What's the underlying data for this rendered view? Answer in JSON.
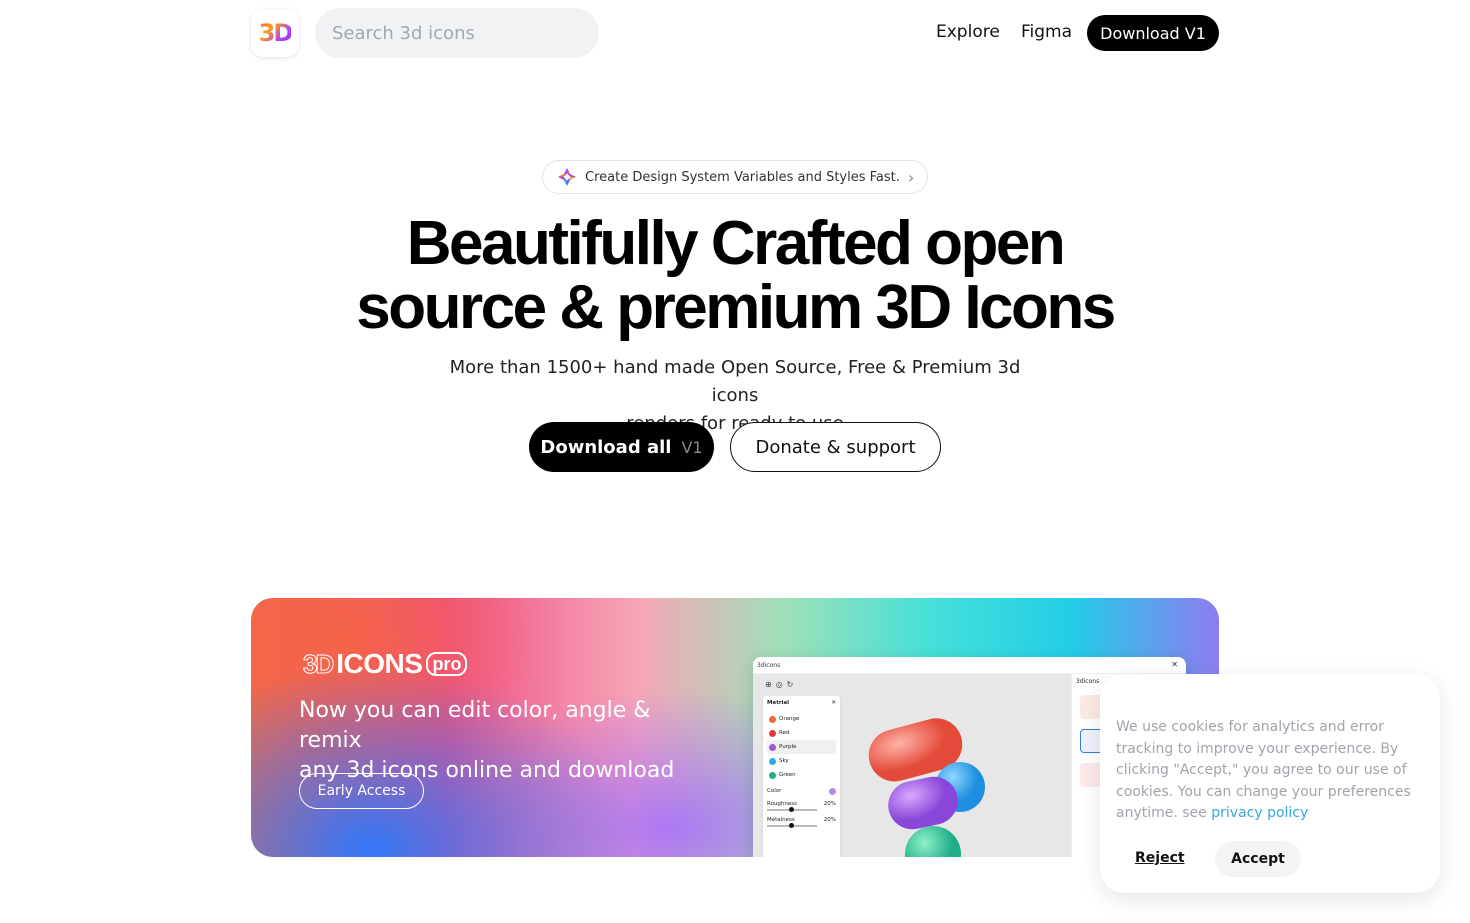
{
  "header": {
    "logo_text": "3D",
    "search_placeholder": "Search 3d icons",
    "nav_explore": "Explore",
    "nav_figma": "Figma",
    "nav_download": "Download V1"
  },
  "hero": {
    "pill_text": "Create Design System Variables and Styles Fast.",
    "title_line1": "Beautifully Crafted open",
    "title_line2": "source & premium 3D Icons",
    "subtitle_line1": "More than 1500+ hand made Open Source, Free & Premium 3d icons",
    "subtitle_line2": "renders for ready to use",
    "download_label": "Download all",
    "download_version": "V1",
    "donate_label": "Donate & support"
  },
  "banner": {
    "logo_3d": "3D",
    "logo_icons": "ICONS",
    "logo_pro": "pro",
    "text_line1": "Now you can edit color, angle & remix",
    "text_line2": "any 3d icons online and download",
    "cta": "Early Access",
    "mock": {
      "title": "3dicons",
      "panel_title": "Metrial",
      "materials": [
        {
          "label": "Orange",
          "color": "#f26a3a"
        },
        {
          "label": "Red",
          "color": "#e23a3a"
        },
        {
          "label": "Purple",
          "color": "#9b59d9"
        },
        {
          "label": "Sky",
          "color": "#2aa7e8"
        },
        {
          "label": "Green",
          "color": "#1fae8a"
        }
      ],
      "color_label": "Color",
      "roughness_label": "Roughness",
      "roughness_value": "20%",
      "metalness_label": "Metalness",
      "metalness_value": "20%",
      "side_title": "3dicons"
    }
  },
  "cookie": {
    "text": "We use cookies for analytics and error tracking to improve your experience. By clicking \"Accept,\" you agree to our use of cookies. You can change your preferences anytime. see ",
    "link": "privacy policy",
    "reject": "Reject",
    "accept": "Accept"
  },
  "colors": {
    "primary": "#000000",
    "search_bg": "#f1f2f4",
    "cookie_text": "#a0a4ab",
    "link": "#35a9e0"
  }
}
